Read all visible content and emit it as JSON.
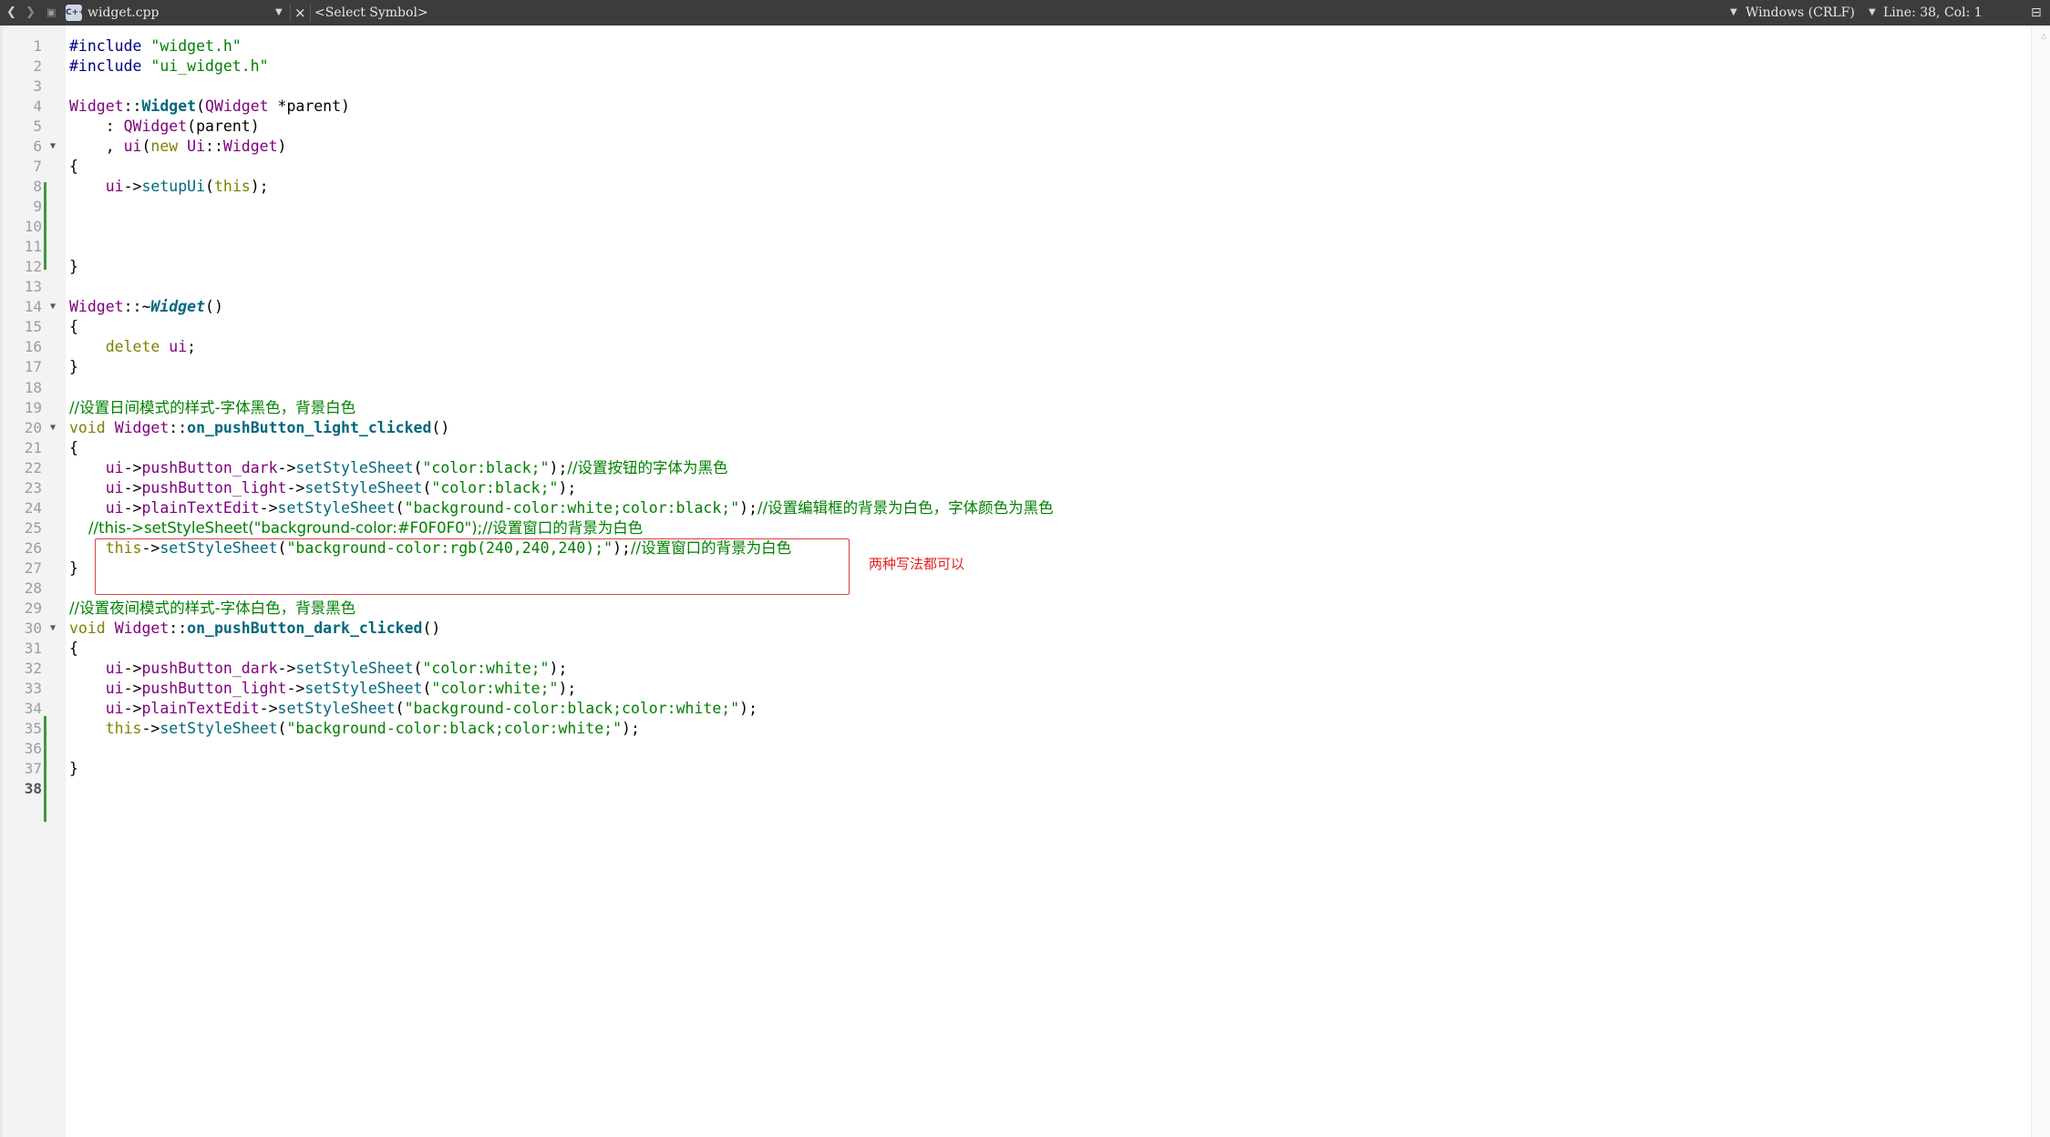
{
  "toolbar": {
    "back_icon": "chevron-left-icon",
    "forward_icon": "chevron-right-icon",
    "file_badge": "C++",
    "file_name": "widget.cpp",
    "close_symbol": "×",
    "symbol_select": "<Select Symbol>",
    "line_ending": "Windows (CRLF)",
    "cursor_position": "Line: 38, Col: 1",
    "split_icon": "split-icon"
  },
  "editor": {
    "current_line": 38,
    "lines": [
      {
        "n": "1",
        "tokens": [
          {
            "t": "#include ",
            "c": "pp"
          },
          {
            "t": "\"widget.h\"",
            "c": "str"
          }
        ]
      },
      {
        "n": "2",
        "tokens": [
          {
            "t": "#include ",
            "c": "pp"
          },
          {
            "t": "\"ui_widget.h\"",
            "c": "str"
          }
        ]
      },
      {
        "n": "3",
        "tokens": []
      },
      {
        "n": "4",
        "tokens": [
          {
            "t": "Widget",
            "c": "cls"
          },
          {
            "t": "::",
            "c": ""
          },
          {
            "t": "Widget",
            "c": "fnbold"
          },
          {
            "t": "(",
            "c": ""
          },
          {
            "t": "QWidget",
            "c": "cls"
          },
          {
            "t": " *parent)",
            "c": ""
          }
        ]
      },
      {
        "n": "5",
        "tokens": [
          {
            "t": "    : ",
            "c": ""
          },
          {
            "t": "QWidget",
            "c": "cls"
          },
          {
            "t": "(parent)",
            "c": ""
          }
        ]
      },
      {
        "n": "6",
        "fold": true,
        "tokens": [
          {
            "t": "    , ",
            "c": ""
          },
          {
            "t": "ui",
            "c": "cls"
          },
          {
            "t": "(",
            "c": ""
          },
          {
            "t": "new",
            "c": "kw"
          },
          {
            "t": " ",
            "c": ""
          },
          {
            "t": "Ui",
            "c": "cls"
          },
          {
            "t": "::",
            "c": ""
          },
          {
            "t": "Widget",
            "c": "cls"
          },
          {
            "t": ")",
            "c": ""
          }
        ]
      },
      {
        "n": "7",
        "tokens": [
          {
            "t": "{",
            "c": ""
          }
        ]
      },
      {
        "n": "8",
        "tokens": [
          {
            "t": "    ",
            "c": ""
          },
          {
            "t": "ui",
            "c": "cls"
          },
          {
            "t": "->",
            "c": ""
          },
          {
            "t": "setupUi",
            "c": "fn"
          },
          {
            "t": "(",
            "c": ""
          },
          {
            "t": "this",
            "c": "kw"
          },
          {
            "t": ");",
            "c": ""
          }
        ]
      },
      {
        "n": "9",
        "tokens": []
      },
      {
        "n": "10",
        "tokens": []
      },
      {
        "n": "11",
        "tokens": []
      },
      {
        "n": "12",
        "tokens": [
          {
            "t": "}",
            "c": ""
          }
        ]
      },
      {
        "n": "13",
        "tokens": []
      },
      {
        "n": "14",
        "fold": true,
        "tokens": [
          {
            "t": "Widget",
            "c": "cls"
          },
          {
            "t": "::~",
            "c": ""
          },
          {
            "t": "Widget",
            "c": "fnital"
          },
          {
            "t": "()",
            "c": ""
          }
        ]
      },
      {
        "n": "15",
        "tokens": [
          {
            "t": "{",
            "c": ""
          }
        ]
      },
      {
        "n": "16",
        "tokens": [
          {
            "t": "    ",
            "c": ""
          },
          {
            "t": "delete",
            "c": "kw"
          },
          {
            "t": " ",
            "c": ""
          },
          {
            "t": "ui",
            "c": "cls"
          },
          {
            "t": ";",
            "c": ""
          }
        ]
      },
      {
        "n": "17",
        "tokens": [
          {
            "t": "}",
            "c": ""
          }
        ]
      },
      {
        "n": "18",
        "tokens": []
      },
      {
        "n": "19",
        "tokens": [
          {
            "t": "//设置日间模式的样式-字体黑色，背景白色",
            "c": "cmt"
          }
        ]
      },
      {
        "n": "20",
        "fold": true,
        "tokens": [
          {
            "t": "void",
            "c": "kw"
          },
          {
            "t": " ",
            "c": ""
          },
          {
            "t": "Widget",
            "c": "cls"
          },
          {
            "t": "::",
            "c": ""
          },
          {
            "t": "on_pushButton_light_clicked",
            "c": "fnbold"
          },
          {
            "t": "()",
            "c": ""
          }
        ]
      },
      {
        "n": "21",
        "tokens": [
          {
            "t": "{",
            "c": ""
          }
        ]
      },
      {
        "n": "22",
        "tokens": [
          {
            "t": "    ",
            "c": ""
          },
          {
            "t": "ui",
            "c": "cls"
          },
          {
            "t": "->",
            "c": ""
          },
          {
            "t": "pushButton_dark",
            "c": "cls"
          },
          {
            "t": "->",
            "c": ""
          },
          {
            "t": "setStyleSheet",
            "c": "fn"
          },
          {
            "t": "(",
            "c": ""
          },
          {
            "t": "\"color:black;\"",
            "c": "str"
          },
          {
            "t": ");",
            "c": ""
          },
          {
            "t": "//设置按钮的字体为黑色",
            "c": "cmt"
          }
        ]
      },
      {
        "n": "23",
        "tokens": [
          {
            "t": "    ",
            "c": ""
          },
          {
            "t": "ui",
            "c": "cls"
          },
          {
            "t": "->",
            "c": ""
          },
          {
            "t": "pushButton_light",
            "c": "cls"
          },
          {
            "t": "->",
            "c": ""
          },
          {
            "t": "setStyleSheet",
            "c": "fn"
          },
          {
            "t": "(",
            "c": ""
          },
          {
            "t": "\"color:black;\"",
            "c": "str"
          },
          {
            "t": ");",
            "c": ""
          }
        ]
      },
      {
        "n": "24",
        "tokens": [
          {
            "t": "    ",
            "c": ""
          },
          {
            "t": "ui",
            "c": "cls"
          },
          {
            "t": "->",
            "c": ""
          },
          {
            "t": "plainTextEdit",
            "c": "cls"
          },
          {
            "t": "->",
            "c": ""
          },
          {
            "t": "setStyleSheet",
            "c": "fn"
          },
          {
            "t": "(",
            "c": ""
          },
          {
            "t": "\"background-color:white;color:black;\"",
            "c": "str"
          },
          {
            "t": ");",
            "c": ""
          },
          {
            "t": "//设置编辑框的背景为白色，字体颜色为黑色",
            "c": "cmt"
          }
        ]
      },
      {
        "n": "25",
        "tokens": [
          {
            "t": "    //this->setStyleSheet(\"background-color:#F0F0F0\");//设置窗口的背景为白色",
            "c": "cmt"
          }
        ]
      },
      {
        "n": "26",
        "tokens": [
          {
            "t": "    ",
            "c": ""
          },
          {
            "t": "this",
            "c": "kw"
          },
          {
            "t": "->",
            "c": ""
          },
          {
            "t": "setStyleSheet",
            "c": "fn"
          },
          {
            "t": "(",
            "c": ""
          },
          {
            "t": "\"background-color:rgb(240,240,240);\"",
            "c": "str"
          },
          {
            "t": ");",
            "c": ""
          },
          {
            "t": "//设置窗口的背景为白色",
            "c": "cmt"
          }
        ]
      },
      {
        "n": "27",
        "tokens": [
          {
            "t": "}",
            "c": ""
          }
        ]
      },
      {
        "n": "28",
        "tokens": []
      },
      {
        "n": "29",
        "tokens": [
          {
            "t": "//设置夜间模式的样式-字体白色，背景黑色",
            "c": "cmt"
          }
        ]
      },
      {
        "n": "30",
        "fold": true,
        "tokens": [
          {
            "t": "void",
            "c": "kw"
          },
          {
            "t": " ",
            "c": ""
          },
          {
            "t": "Widget",
            "c": "cls"
          },
          {
            "t": "::",
            "c": ""
          },
          {
            "t": "on_pushButton_dark_clicked",
            "c": "fnbold"
          },
          {
            "t": "()",
            "c": ""
          }
        ]
      },
      {
        "n": "31",
        "tokens": [
          {
            "t": "{",
            "c": ""
          }
        ]
      },
      {
        "n": "32",
        "tokens": [
          {
            "t": "    ",
            "c": ""
          },
          {
            "t": "ui",
            "c": "cls"
          },
          {
            "t": "->",
            "c": ""
          },
          {
            "t": "pushButton_dark",
            "c": "cls"
          },
          {
            "t": "->",
            "c": ""
          },
          {
            "t": "setStyleSheet",
            "c": "fn"
          },
          {
            "t": "(",
            "c": ""
          },
          {
            "t": "\"color:white;\"",
            "c": "str"
          },
          {
            "t": ");",
            "c": ""
          }
        ]
      },
      {
        "n": "33",
        "tokens": [
          {
            "t": "    ",
            "c": ""
          },
          {
            "t": "ui",
            "c": "cls"
          },
          {
            "t": "->",
            "c": ""
          },
          {
            "t": "pushButton_light",
            "c": "cls"
          },
          {
            "t": "->",
            "c": ""
          },
          {
            "t": "setStyleSheet",
            "c": "fn"
          },
          {
            "t": "(",
            "c": ""
          },
          {
            "t": "\"color:white;\"",
            "c": "str"
          },
          {
            "t": ");",
            "c": ""
          }
        ]
      },
      {
        "n": "34",
        "tokens": [
          {
            "t": "    ",
            "c": ""
          },
          {
            "t": "ui",
            "c": "cls"
          },
          {
            "t": "->",
            "c": ""
          },
          {
            "t": "plainTextEdit",
            "c": "cls"
          },
          {
            "t": "->",
            "c": ""
          },
          {
            "t": "setStyleSheet",
            "c": "fn"
          },
          {
            "t": "(",
            "c": ""
          },
          {
            "t": "\"background-color:black;color:white;\"",
            "c": "str"
          },
          {
            "t": ");",
            "c": ""
          }
        ]
      },
      {
        "n": "35",
        "tokens": [
          {
            "t": "    ",
            "c": ""
          },
          {
            "t": "this",
            "c": "kw"
          },
          {
            "t": "->",
            "c": ""
          },
          {
            "t": "setStyleSheet",
            "c": "fn"
          },
          {
            "t": "(",
            "c": ""
          },
          {
            "t": "\"background-color:black;color:white;\"",
            "c": "str"
          },
          {
            "t": ");",
            "c": ""
          }
        ]
      },
      {
        "n": "36",
        "tokens": []
      },
      {
        "n": "37",
        "tokens": [
          {
            "t": "}",
            "c": ""
          }
        ]
      },
      {
        "n": "38",
        "tokens": []
      }
    ]
  },
  "annotation": {
    "text": "两种写法都可以",
    "color": "#e02020"
  },
  "colors": {
    "toolbar_bg": "#3c3c3c",
    "keyword": "#808000",
    "class": "#800080",
    "function": "#00677c",
    "string_comment": "#008000",
    "change_marker": "#3c9a3c"
  }
}
